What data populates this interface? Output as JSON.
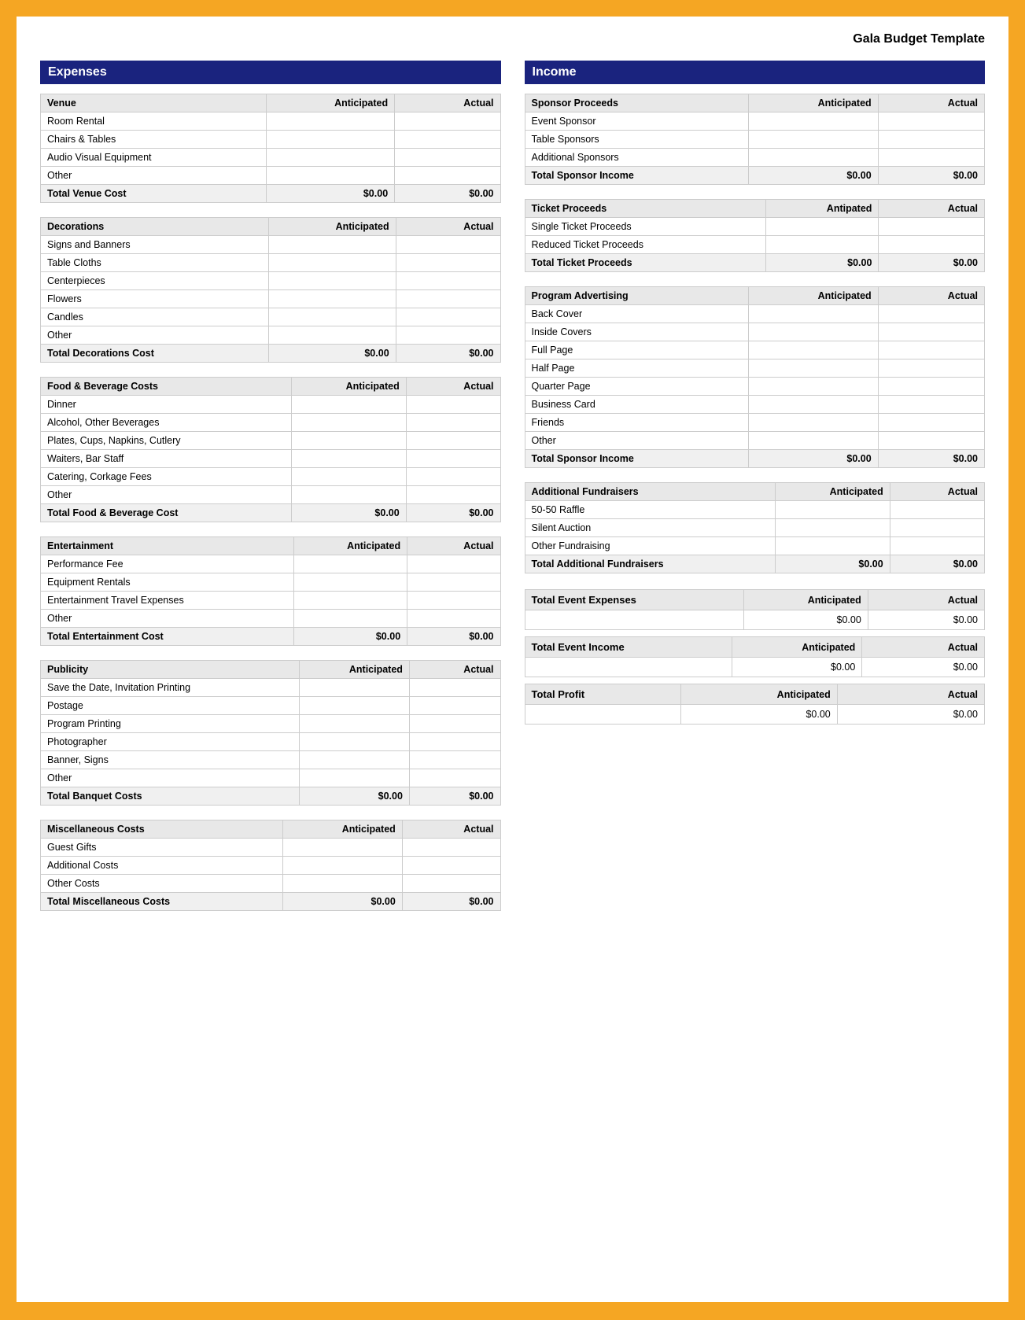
{
  "title": "Gala Budget Template",
  "sections": {
    "expenses_header": "Expenses",
    "income_header": "Income"
  },
  "expenses": {
    "venue": {
      "header": "Venue",
      "cols": [
        "Anticipated",
        "Actual"
      ],
      "rows": [
        [
          "Room Rental",
          "",
          ""
        ],
        [
          "Chairs & Tables",
          "",
          ""
        ],
        [
          "Audio Visual Equipment",
          "",
          ""
        ],
        [
          "Other",
          "",
          ""
        ]
      ],
      "total_label": "Total Venue Cost",
      "total_anticipated": "$0.00",
      "total_actual": "$0.00"
    },
    "decorations": {
      "header": "Decorations",
      "cols": [
        "Anticipated",
        "Actual"
      ],
      "rows": [
        [
          "Signs and Banners",
          "",
          ""
        ],
        [
          "Table Cloths",
          "",
          ""
        ],
        [
          "Centerpieces",
          "",
          ""
        ],
        [
          "Flowers",
          "",
          ""
        ],
        [
          "Candles",
          "",
          ""
        ],
        [
          "Other",
          "",
          ""
        ]
      ],
      "total_label": "Total Decorations Cost",
      "total_anticipated": "$0.00",
      "total_actual": "$0.00"
    },
    "food_beverage": {
      "header": "Food & Beverage Costs",
      "cols": [
        "Anticipated",
        "Actual"
      ],
      "rows": [
        [
          "Dinner",
          "",
          ""
        ],
        [
          "Alcohol, Other Beverages",
          "",
          ""
        ],
        [
          "Plates, Cups, Napkins, Cutlery",
          "",
          ""
        ],
        [
          "Waiters, Bar Staff",
          "",
          ""
        ],
        [
          "Catering, Corkage Fees",
          "",
          ""
        ],
        [
          "Other",
          "",
          ""
        ]
      ],
      "total_label": "Total Food & Beverage Cost",
      "total_anticipated": "$0.00",
      "total_actual": "$0.00"
    },
    "entertainment": {
      "header": "Entertainment",
      "cols": [
        "Anticipated",
        "Actual"
      ],
      "rows": [
        [
          "Performance Fee",
          "",
          ""
        ],
        [
          "Equipment Rentals",
          "",
          ""
        ],
        [
          "Entertainment Travel Expenses",
          "",
          ""
        ],
        [
          "Other",
          "",
          ""
        ]
      ],
      "total_label": "Total Entertainment Cost",
      "total_anticipated": "$0.00",
      "total_actual": "$0.00"
    },
    "publicity": {
      "header": "Publicity",
      "cols": [
        "Anticipated",
        "Actual"
      ],
      "rows": [
        [
          "Save the Date, Invitation Printing",
          "",
          ""
        ],
        [
          "Postage",
          "",
          ""
        ],
        [
          "Program Printing",
          "",
          ""
        ],
        [
          "Photographer",
          "",
          ""
        ],
        [
          "Banner, Signs",
          "",
          ""
        ],
        [
          "Other",
          "",
          ""
        ]
      ],
      "total_label": "Total Banquet Costs",
      "total_anticipated": "$0.00",
      "total_actual": "$0.00"
    },
    "miscellaneous": {
      "header": "Miscellaneous Costs",
      "cols": [
        "Anticipated",
        "Actual"
      ],
      "rows": [
        [
          "Guest Gifts",
          "",
          ""
        ],
        [
          "Additional Costs",
          "",
          ""
        ],
        [
          "Other Costs",
          "",
          ""
        ]
      ],
      "total_label": "Total Miscellaneous Costs",
      "total_anticipated": "$0.00",
      "total_actual": "$0.00"
    }
  },
  "income": {
    "sponsor": {
      "header": "Sponsor Proceeds",
      "cols": [
        "Anticipated",
        "Actual"
      ],
      "rows": [
        [
          "Event Sponsor",
          "",
          ""
        ],
        [
          "Table Sponsors",
          "",
          ""
        ],
        [
          "Additional Sponsors",
          "",
          ""
        ]
      ],
      "total_label": "Total Sponsor Income",
      "total_anticipated": "$0.00",
      "total_actual": "$0.00"
    },
    "ticket": {
      "header": "Ticket Proceeds",
      "cols": [
        "Antipated",
        "Actual"
      ],
      "rows": [
        [
          "Single Ticket Proceeds",
          "",
          ""
        ],
        [
          "Reduced Ticket Proceeds",
          "",
          ""
        ]
      ],
      "total_label": "Total Ticket Proceeds",
      "total_anticipated": "$0.00",
      "total_actual": "$0.00"
    },
    "program": {
      "header": "Program Advertising",
      "cols": [
        "Anticipated",
        "Actual"
      ],
      "rows": [
        [
          "Back Cover",
          "",
          ""
        ],
        [
          "Inside Covers",
          "",
          ""
        ],
        [
          "Full Page",
          "",
          ""
        ],
        [
          "Half Page",
          "",
          ""
        ],
        [
          "Quarter Page",
          "",
          ""
        ],
        [
          "Business Card",
          "",
          ""
        ],
        [
          "Friends",
          "",
          ""
        ],
        [
          "Other",
          "",
          ""
        ]
      ],
      "total_label": "Total Sponsor Income",
      "total_anticipated": "$0.00",
      "total_actual": "$0.00"
    },
    "fundraisers": {
      "header": "Additional Fundraisers",
      "cols": [
        "Anticipated",
        "Actual"
      ],
      "rows": [
        [
          "50-50 Raffle",
          "",
          ""
        ],
        [
          "Silent Auction",
          "",
          ""
        ],
        [
          "Other Fundraising",
          "",
          ""
        ]
      ],
      "total_label": "Total Additional Fundraisers",
      "total_anticipated": "$0.00",
      "total_actual": "$0.00"
    }
  },
  "summary": {
    "expenses": {
      "label": "Total Event Expenses",
      "cols": [
        "Anticipated",
        "Actual"
      ],
      "anticipated": "$0.00",
      "actual": "$0.00"
    },
    "income": {
      "label": "Total Event Income",
      "cols": [
        "Anticipated",
        "Actual"
      ],
      "anticipated": "$0.00",
      "actual": "$0.00"
    },
    "profit": {
      "label": "Total Profit",
      "cols": [
        "Anticipated",
        "Actual"
      ],
      "anticipated": "$0.00",
      "actual": "$0.00"
    }
  }
}
